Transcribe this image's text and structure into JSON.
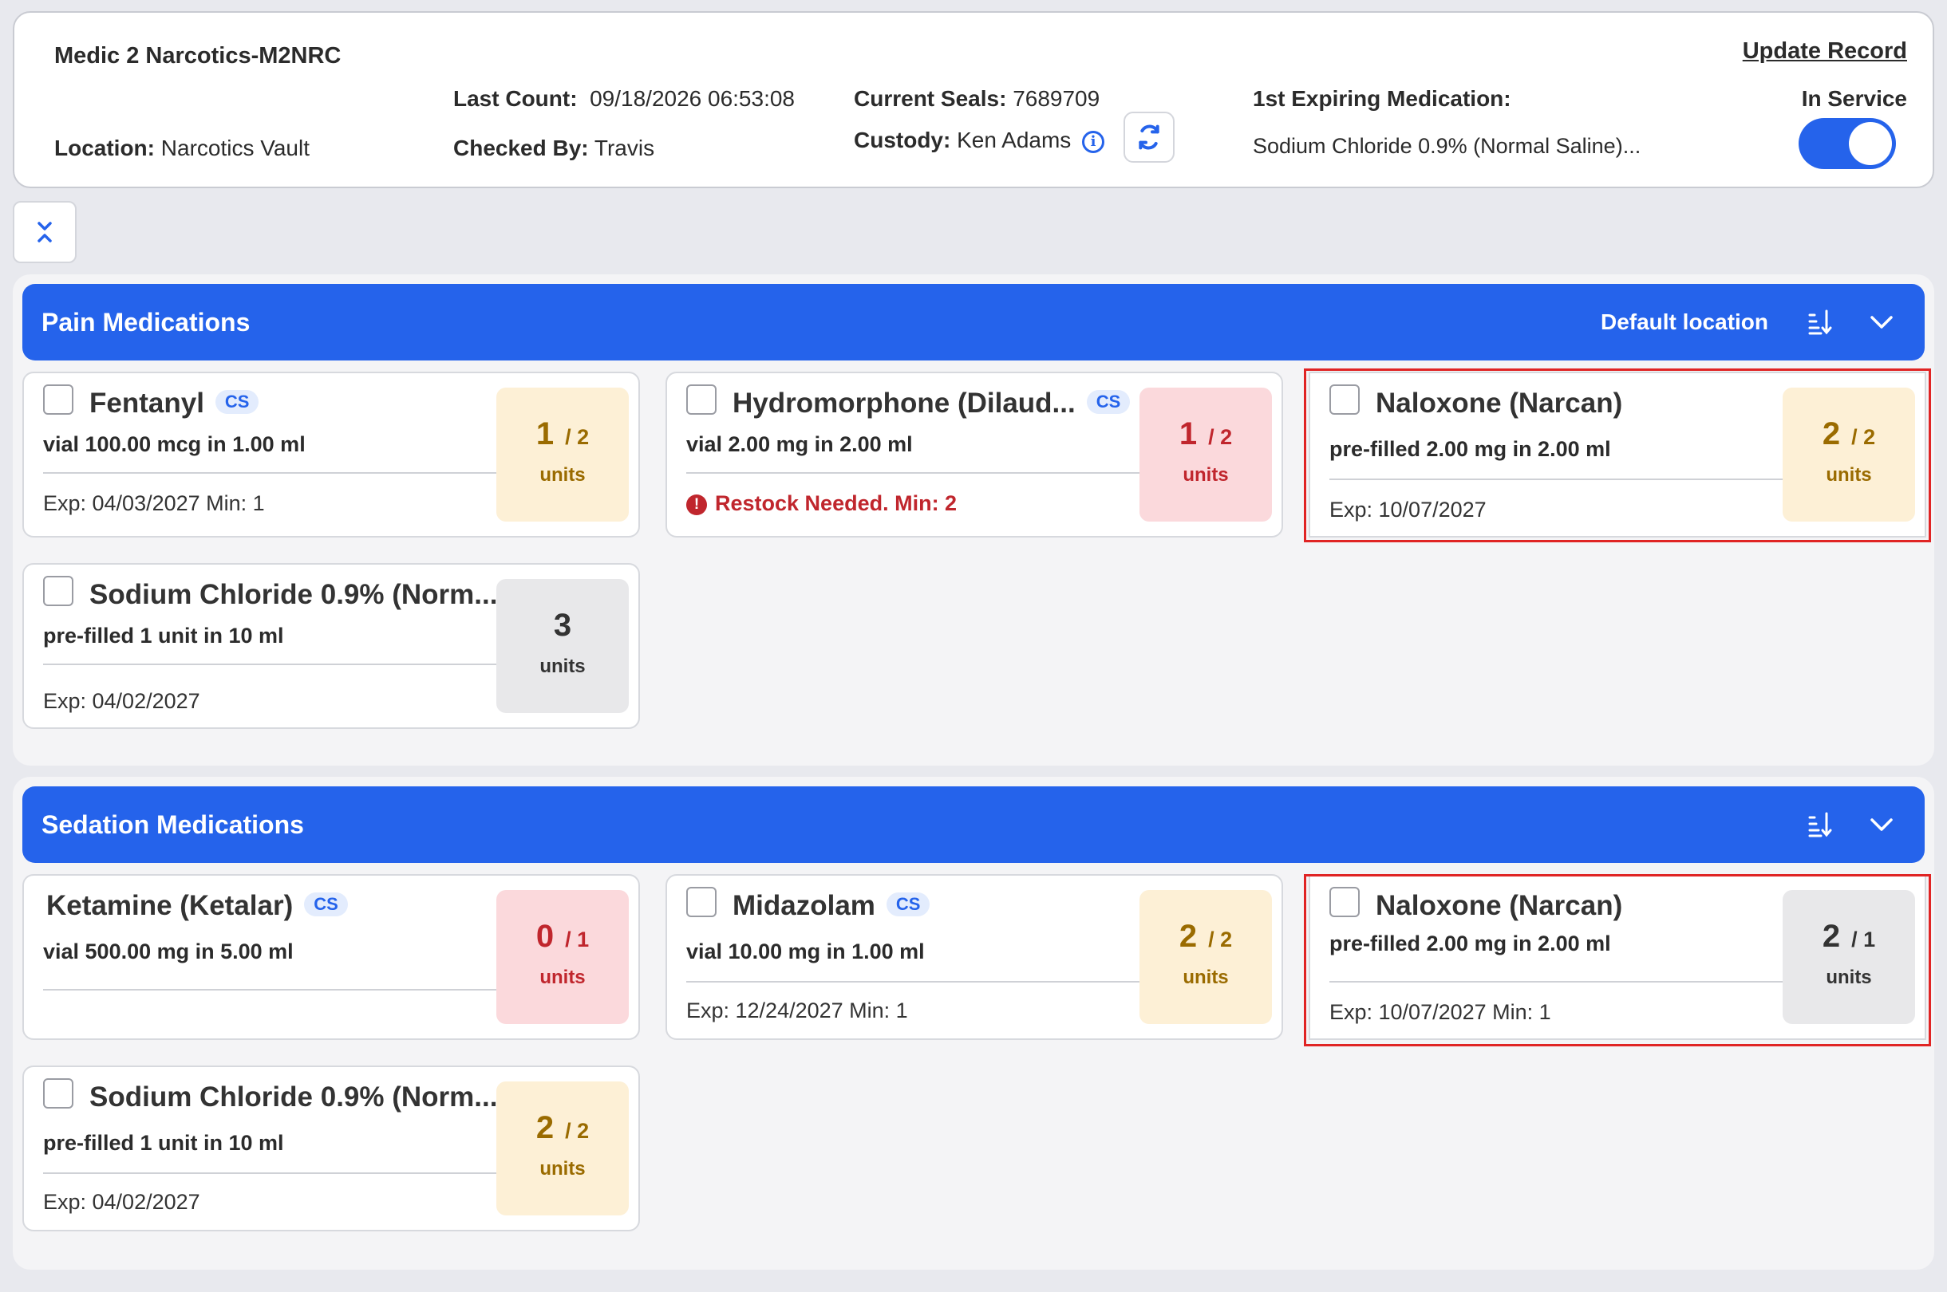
{
  "header": {
    "unit_name": "Medic 2 Narcotics-M2NRC",
    "location_label": "Location:",
    "location_value": "Narcotics Vault",
    "last_count_label": "Last Count:",
    "last_count_value": "09/18/2026 06:53:08",
    "checked_by_label": "Checked By:",
    "checked_by_value": "Travis",
    "seals_label": "Current Seals:",
    "seals_value": "7689709",
    "custody_label": "Custody:",
    "custody_value": "Ken Adams",
    "first_exp_label": "1st Expiring Medication:",
    "first_exp_value": "Sodium Chloride 0.9% (Normal Saline)...",
    "update_record": "Update Record",
    "in_service_label": "In Service",
    "in_service_on": true
  },
  "colors": {
    "primary": "#2563eb",
    "amber_bg": "#fdf0d6",
    "pink_bg": "#fbd9dc",
    "gray_bg": "#e8e8ea",
    "highlight": "#e02424"
  },
  "icons": {
    "info": "info-icon",
    "refresh": "refresh-icon",
    "collapse": "collapse-all-icon",
    "sort": "sort-icon",
    "chevron": "chevron-down-icon",
    "alert": "alert-icon"
  },
  "sections": [
    {
      "title": "Pain Medications",
      "default_location": "Default location",
      "cards": [
        {
          "name": "Fentanyl",
          "cs": "CS",
          "dose": "vial 100.00 mcg in 1.00 ml",
          "footer": "Exp: 04/03/2027 Min: 1",
          "qty": "1",
          "par": "/ 2",
          "units": "units"
        },
        {
          "name": "Hydromorphone (Dilaud...",
          "cs": "CS",
          "dose": "vial 2.00 mg in 2.00 ml",
          "footer": "Restock Needed.  Min: 2",
          "qty": "1",
          "par": "/ 2",
          "units": "units"
        },
        {
          "name": "Naloxone (Narcan)",
          "dose": "pre-filled 2.00 mg in 2.00 ml",
          "footer": "Exp: 10/07/2027",
          "qty": "2",
          "par": "/ 2",
          "units": "units"
        },
        {
          "name": "Sodium Chloride 0.9% (Norm...",
          "dose": "pre-filled 1 unit in 10 ml",
          "footer": "Exp: 04/02/2027",
          "qty": "3",
          "units": "units"
        }
      ]
    },
    {
      "title": "Sedation Medications",
      "cards": [
        {
          "name": "Ketamine (Ketalar)",
          "cs": "CS",
          "dose": "vial 500.00 mg in 5.00 ml",
          "footer": "",
          "qty": "0",
          "par": "/ 1",
          "units": "units"
        },
        {
          "name": "Midazolam",
          "cs": "CS",
          "dose": "vial 10.00 mg in 1.00 ml",
          "footer": "Exp: 12/24/2027  Min: 1",
          "qty": "2",
          "par": "/ 2",
          "units": "units"
        },
        {
          "name": "Naloxone (Narcan)",
          "dose": "pre-filled 2.00 mg in 2.00 ml",
          "footer": "Exp: 10/07/2027 Min: 1",
          "qty": "2",
          "par": "/ 1",
          "units": "units"
        },
        {
          "name": "Sodium Chloride 0.9% (Norm...",
          "dose": "pre-filled 1 unit in 10 ml",
          "footer": "Exp: 04/02/2027",
          "qty": "2",
          "par": "/ 2",
          "units": "units"
        }
      ]
    }
  ]
}
